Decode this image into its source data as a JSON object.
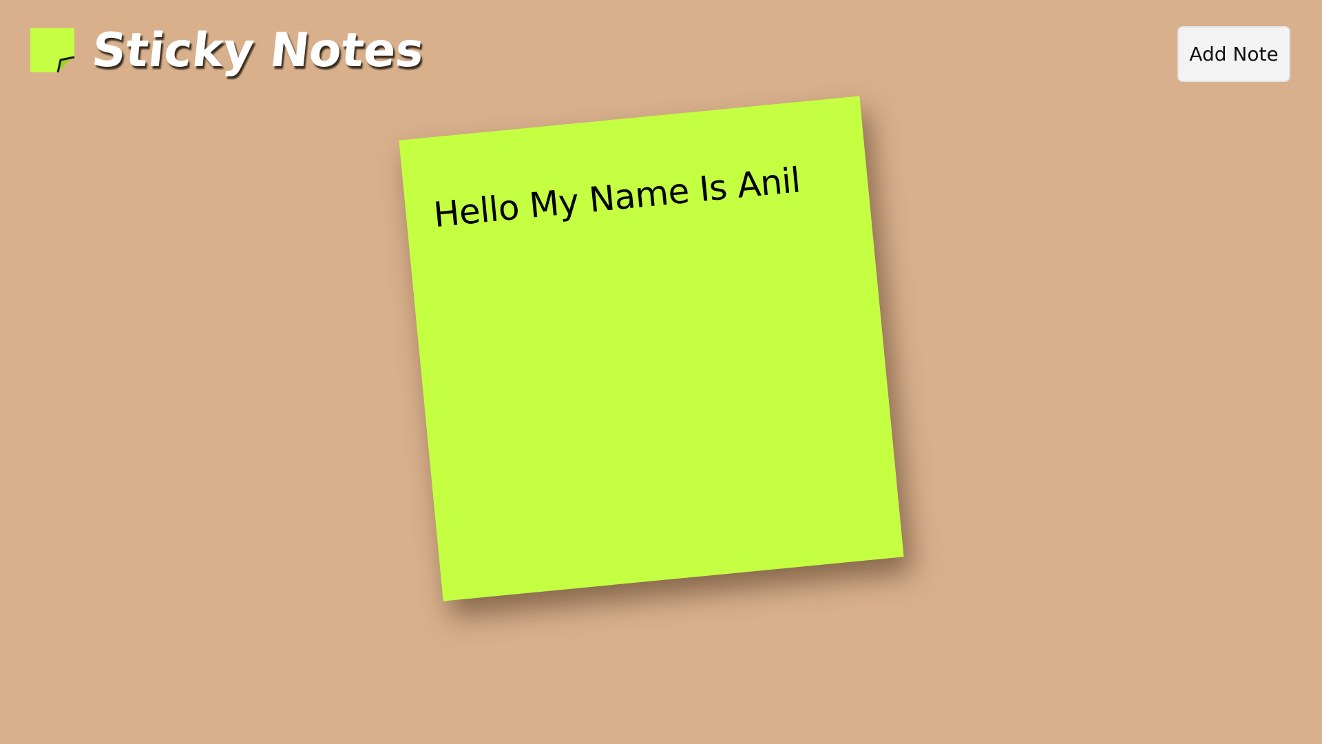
{
  "app": {
    "title": "Sticky Notes",
    "accent_color": "#c4ff41",
    "background_color": "#d8b08c",
    "logo_icon": "sticky-note-icon"
  },
  "toolbar": {
    "add_label": "Add Note"
  },
  "notes": [
    {
      "text": "Hello My Name Is Anil",
      "color": "#c4ff41"
    }
  ]
}
